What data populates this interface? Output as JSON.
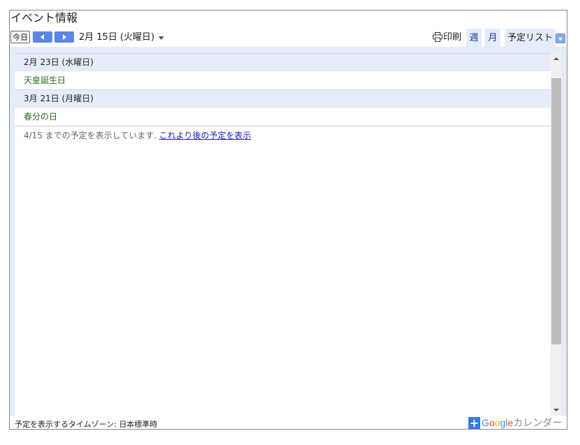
{
  "calendar": {
    "title": "イベント情報",
    "toolbar": {
      "today_label": "今日",
      "date_range": "2月 15日 (火曜日)",
      "print_label": "印刷",
      "tabs": {
        "week": "週",
        "month": "月",
        "agenda": "予定リスト"
      }
    },
    "agenda": {
      "days": [
        {
          "date": "2月 23日 (水曜日)",
          "events": [
            "天皇誕生日"
          ]
        },
        {
          "date": "3月 21日 (月曜日)",
          "events": [
            "春分の日"
          ]
        }
      ],
      "note_text": "4/15 までの予定を表示しています.",
      "note_link": "これより後の予定を表示"
    },
    "footer": {
      "timezone": "予定を表示するタイムゾーン: 日本標準時",
      "google_label": "Google",
      "calendar_label": "カレンダー"
    },
    "colors": {
      "accent": "#5b86e6",
      "header_bg": "#e5ecf9",
      "event_text": "#2b6b1f",
      "link": "#2020c0"
    },
    "icons": {
      "prev": "chevron-left-icon",
      "next": "chevron-right-icon",
      "print": "printer-icon",
      "add": "plus-icon"
    }
  }
}
